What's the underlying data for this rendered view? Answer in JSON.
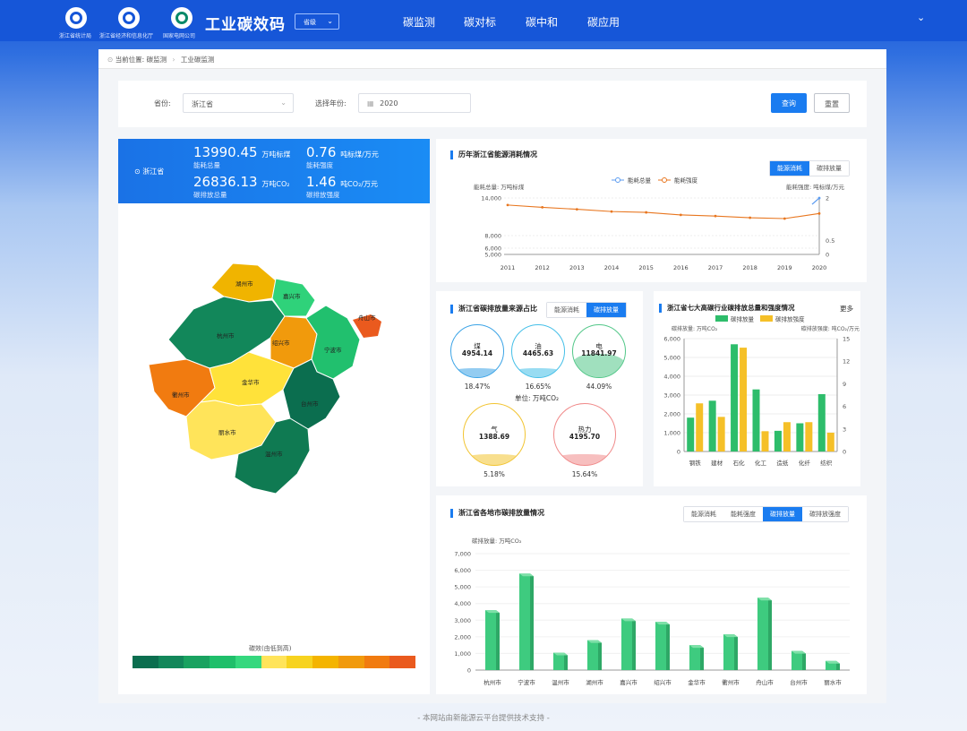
{
  "header": {
    "logos": [
      {
        "caption": "浙江省统计局",
        "icon": "stats-bureau-logo-icon"
      },
      {
        "caption": "浙江省经济和信息化厅",
        "icon": "economy-dept-logo-icon"
      },
      {
        "caption": "国家电网公司",
        "icon": "state-grid-logo-icon"
      }
    ],
    "title": "工业碳效码",
    "level_select": "省级",
    "nav": [
      "碳监测",
      "碳对标",
      "碳中和",
      "碳应用"
    ],
    "collapse_icon": "chevron-down-icon",
    "colors": {
      "bar": "#1656d8",
      "accent": "#1a7cf0"
    }
  },
  "breadcrumb": {
    "prefix": "当前位置:",
    "items": [
      "碳监测",
      "工业碳监测"
    ]
  },
  "filter": {
    "province_label": "省份:",
    "province_value": "浙江省",
    "year_label": "选择年份:",
    "year_value": "2020",
    "query_button": "查询",
    "reset_button": "重置"
  },
  "stats": {
    "region": "浙江省",
    "energy_total": {
      "value": "13990.45",
      "unit": "万吨标煤",
      "label": "能耗总量"
    },
    "energy_intensity": {
      "value": "0.76",
      "unit": "吨标煤/万元",
      "label": "能耗强度"
    },
    "carbon_total": {
      "value": "26836.13",
      "unit": "万吨CO₂",
      "label": "碳排放总量"
    },
    "carbon_intensity": {
      "value": "1.46",
      "unit": "吨CO₂/万元",
      "label": "碳排放强度"
    }
  },
  "map": {
    "cities": [
      "湖州市",
      "嘉兴市",
      "杭州市",
      "绍兴市",
      "宁波市",
      "舟山市",
      "衢州市",
      "金华市",
      "台州市",
      "丽水市",
      "温州市"
    ],
    "legend_title": "碳效(由低到高)",
    "legend_colors": [
      "#0b6e4f",
      "#12875a",
      "#19a260",
      "#1fbf6a",
      "#35d87e",
      "#ffe45a",
      "#f7d31f",
      "#f4b400",
      "#f19a0c",
      "#f17b10",
      "#ea5a1e"
    ]
  },
  "energy_history": {
    "title": "历年浙江省能源消耗情况",
    "tabs": [
      "能源消耗",
      "碳排放量"
    ],
    "active_tab": 0
  },
  "emission_sources": {
    "title": "浙江省碳排放量来源占比",
    "tabs": [
      "能源消耗",
      "碳排放量"
    ],
    "active_tab": 1,
    "unit": "单位: 万吨CO₂",
    "items": [
      {
        "name": "煤",
        "value": "4954.14",
        "pct": "18.47%",
        "level": 0.18
      },
      {
        "name": "油",
        "value": "4465.63",
        "pct": "16.65%",
        "level": 0.17
      },
      {
        "name": "电",
        "value": "11841.97",
        "pct": "44.09%",
        "level": 0.44
      },
      {
        "name": "气",
        "value": "1388.69",
        "pct": "5.18%",
        "level": 0.05
      },
      {
        "name": "热力",
        "value": "4195.70",
        "pct": "15.64%",
        "level": 0.16
      }
    ]
  },
  "industries": {
    "title": "浙江省七大高碳行业碳排放总量和强度情况",
    "more": "更多"
  },
  "cities_chart": {
    "title": "浙江省各地市碳排放量情况",
    "tabs": [
      "能源消耗",
      "能耗强度",
      "碳排放量",
      "碳排放强度"
    ],
    "active_tab": 2
  },
  "chart_data": [
    {
      "id": "energy_history",
      "type": "line",
      "x": [
        "2011",
        "2012",
        "2013",
        "2014",
        "2015",
        "2016",
        "2017",
        "2018",
        "2019",
        "2020"
      ],
      "series": [
        {
          "name": "能耗总量",
          "axis": "left",
          "color": "#5b9bf0",
          "values": [
            null,
            null,
            null,
            null,
            null,
            null,
            null,
            null,
            null,
            13990.45
          ]
        },
        {
          "name": "能耗强度",
          "axis": "right",
          "color": "#e8761f",
          "values": [
            1.75,
            1.67,
            1.6,
            1.52,
            1.49,
            1.4,
            1.36,
            1.3,
            1.27,
            1.45
          ]
        }
      ],
      "ylabel_left": "能耗总量: 万吨标煤",
      "ylabel_right": "能耗强度: 吨标煤/万元",
      "y_left_ticks": [
        "5,000",
        "6,000",
        "8,000",
        "14,000"
      ],
      "y_right_ticks": [
        "0",
        "0.5",
        "2"
      ],
      "grid": true,
      "legend": "top-center"
    },
    {
      "id": "industries",
      "type": "bar",
      "categories": [
        "钢铁",
        "建材",
        "石化",
        "化工",
        "造纸",
        "化纤",
        "纺织"
      ],
      "series": [
        {
          "name": "碳排放量",
          "axis": "left",
          "color": "#2ebd6b",
          "values": [
            1800,
            2700,
            5700,
            3300,
            1100,
            1500,
            3050
          ]
        },
        {
          "name": "碳排放强度",
          "axis": "right",
          "color": "#f5c028",
          "values": [
            6.4,
            4.6,
            13.8,
            2.7,
            3.9,
            3.9,
            2.5
          ]
        }
      ],
      "ylabel_left": "碳排放量: 万吨CO₂",
      "ylabel_right": "碳排放强度: 吨CO₂/万元",
      "ylim_left": [
        0,
        6000
      ],
      "ylim_right": [
        0,
        15
      ],
      "y_left_ticks": [
        "0",
        "1,000",
        "2,000",
        "3,000",
        "4,000",
        "5,000",
        "6,000"
      ],
      "y_right_ticks": [
        "0",
        "3",
        "6",
        "9",
        "12",
        "15"
      ],
      "legend": "top-center"
    },
    {
      "id": "cities",
      "type": "bar",
      "categories": [
        "杭州市",
        "宁波市",
        "温州市",
        "湖州市",
        "嘉兴市",
        "绍兴市",
        "金华市",
        "衢州市",
        "舟山市",
        "台州市",
        "丽水市"
      ],
      "series": [
        {
          "color": "#3ecb7f",
          "values": [
            3600,
            5800,
            1050,
            1800,
            3100,
            2900,
            1500,
            2150,
            4350,
            1150,
            550
          ]
        }
      ],
      "ylabel": "碳排放量: 万吨CO₂",
      "ylim": [
        0,
        7000
      ],
      "y_ticks": [
        "0",
        "1,000",
        "2,000",
        "3,000",
        "4,000",
        "5,000",
        "6,000",
        "7,000"
      ]
    }
  ],
  "footer": "- 本网站由新能源云平台提供技术支持 -"
}
